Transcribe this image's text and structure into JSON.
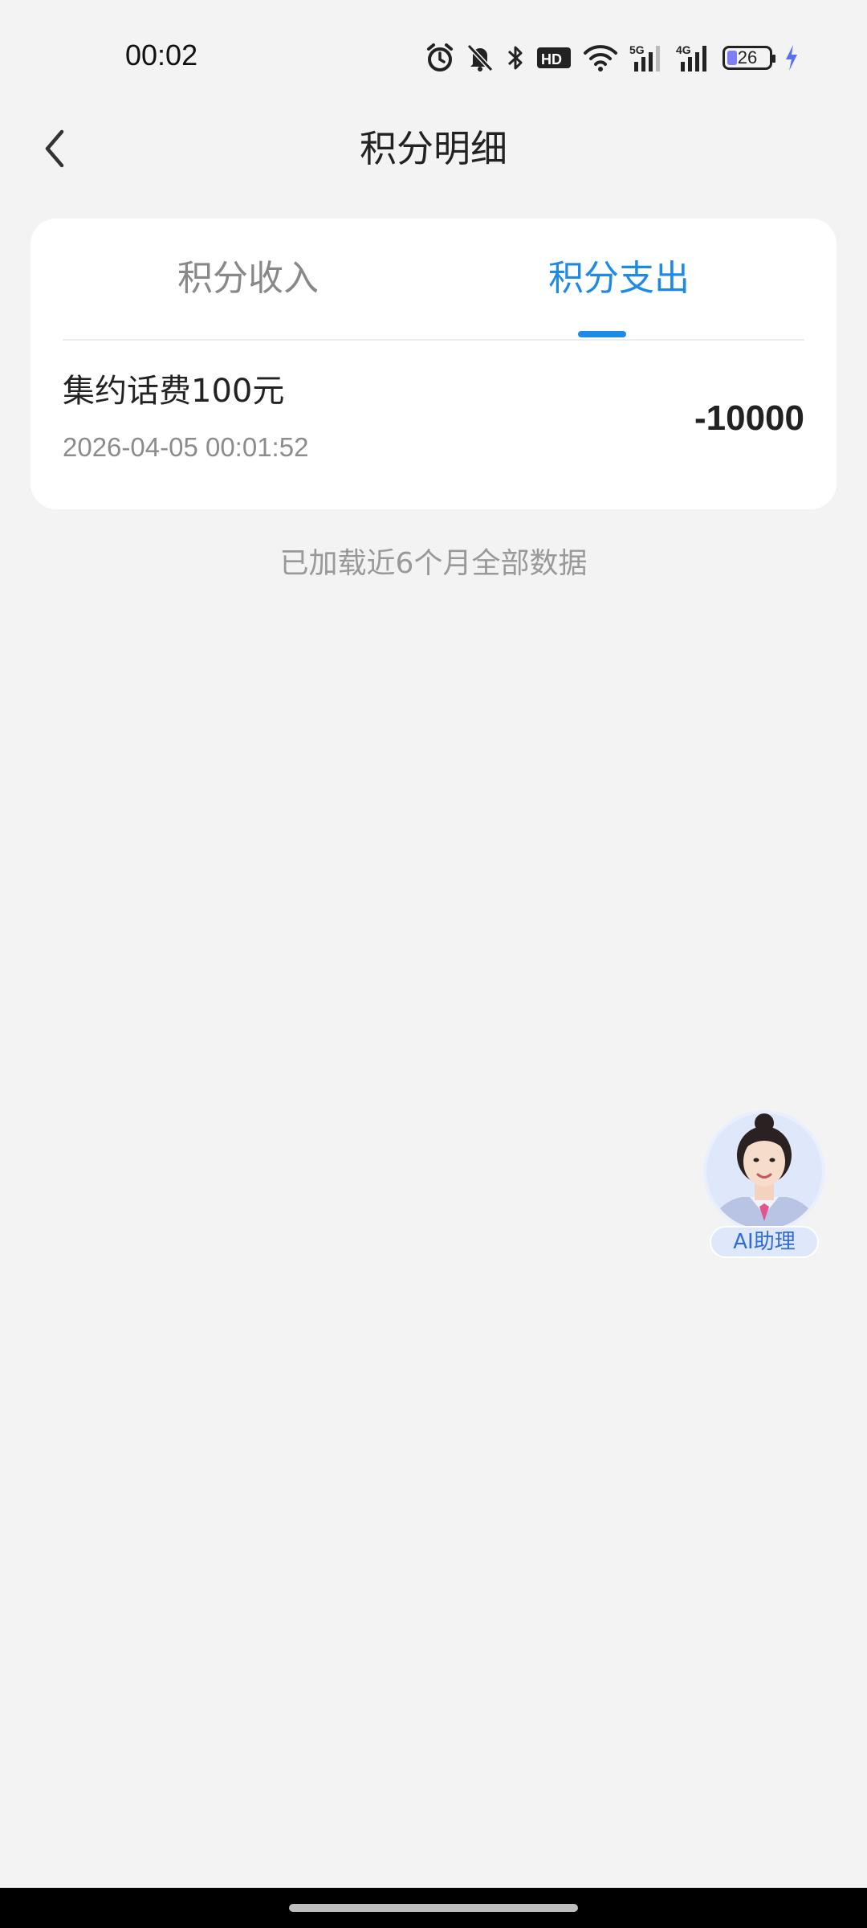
{
  "status_bar": {
    "time": "00:02",
    "battery_level": "26",
    "network_5g": "5G",
    "network_4g": "4G",
    "hd": "HD"
  },
  "header": {
    "title": "积分明细",
    "back_icon": "chevron-left-icon"
  },
  "tabs": [
    {
      "label": "积分收入",
      "active": false
    },
    {
      "label": "积分支出",
      "active": true
    }
  ],
  "colors": {
    "accent": "#1e8ae8",
    "background": "#f3f3f3",
    "card": "#ffffff"
  },
  "records": [
    {
      "title": "集约话费100元",
      "datetime": "2026-04-05 00:01:52",
      "amount": "-10000"
    }
  ],
  "load_hint": "已加载近6个月全部数据",
  "ai_assistant": {
    "label": "AI助理",
    "icon": "assistant-avatar-icon"
  }
}
